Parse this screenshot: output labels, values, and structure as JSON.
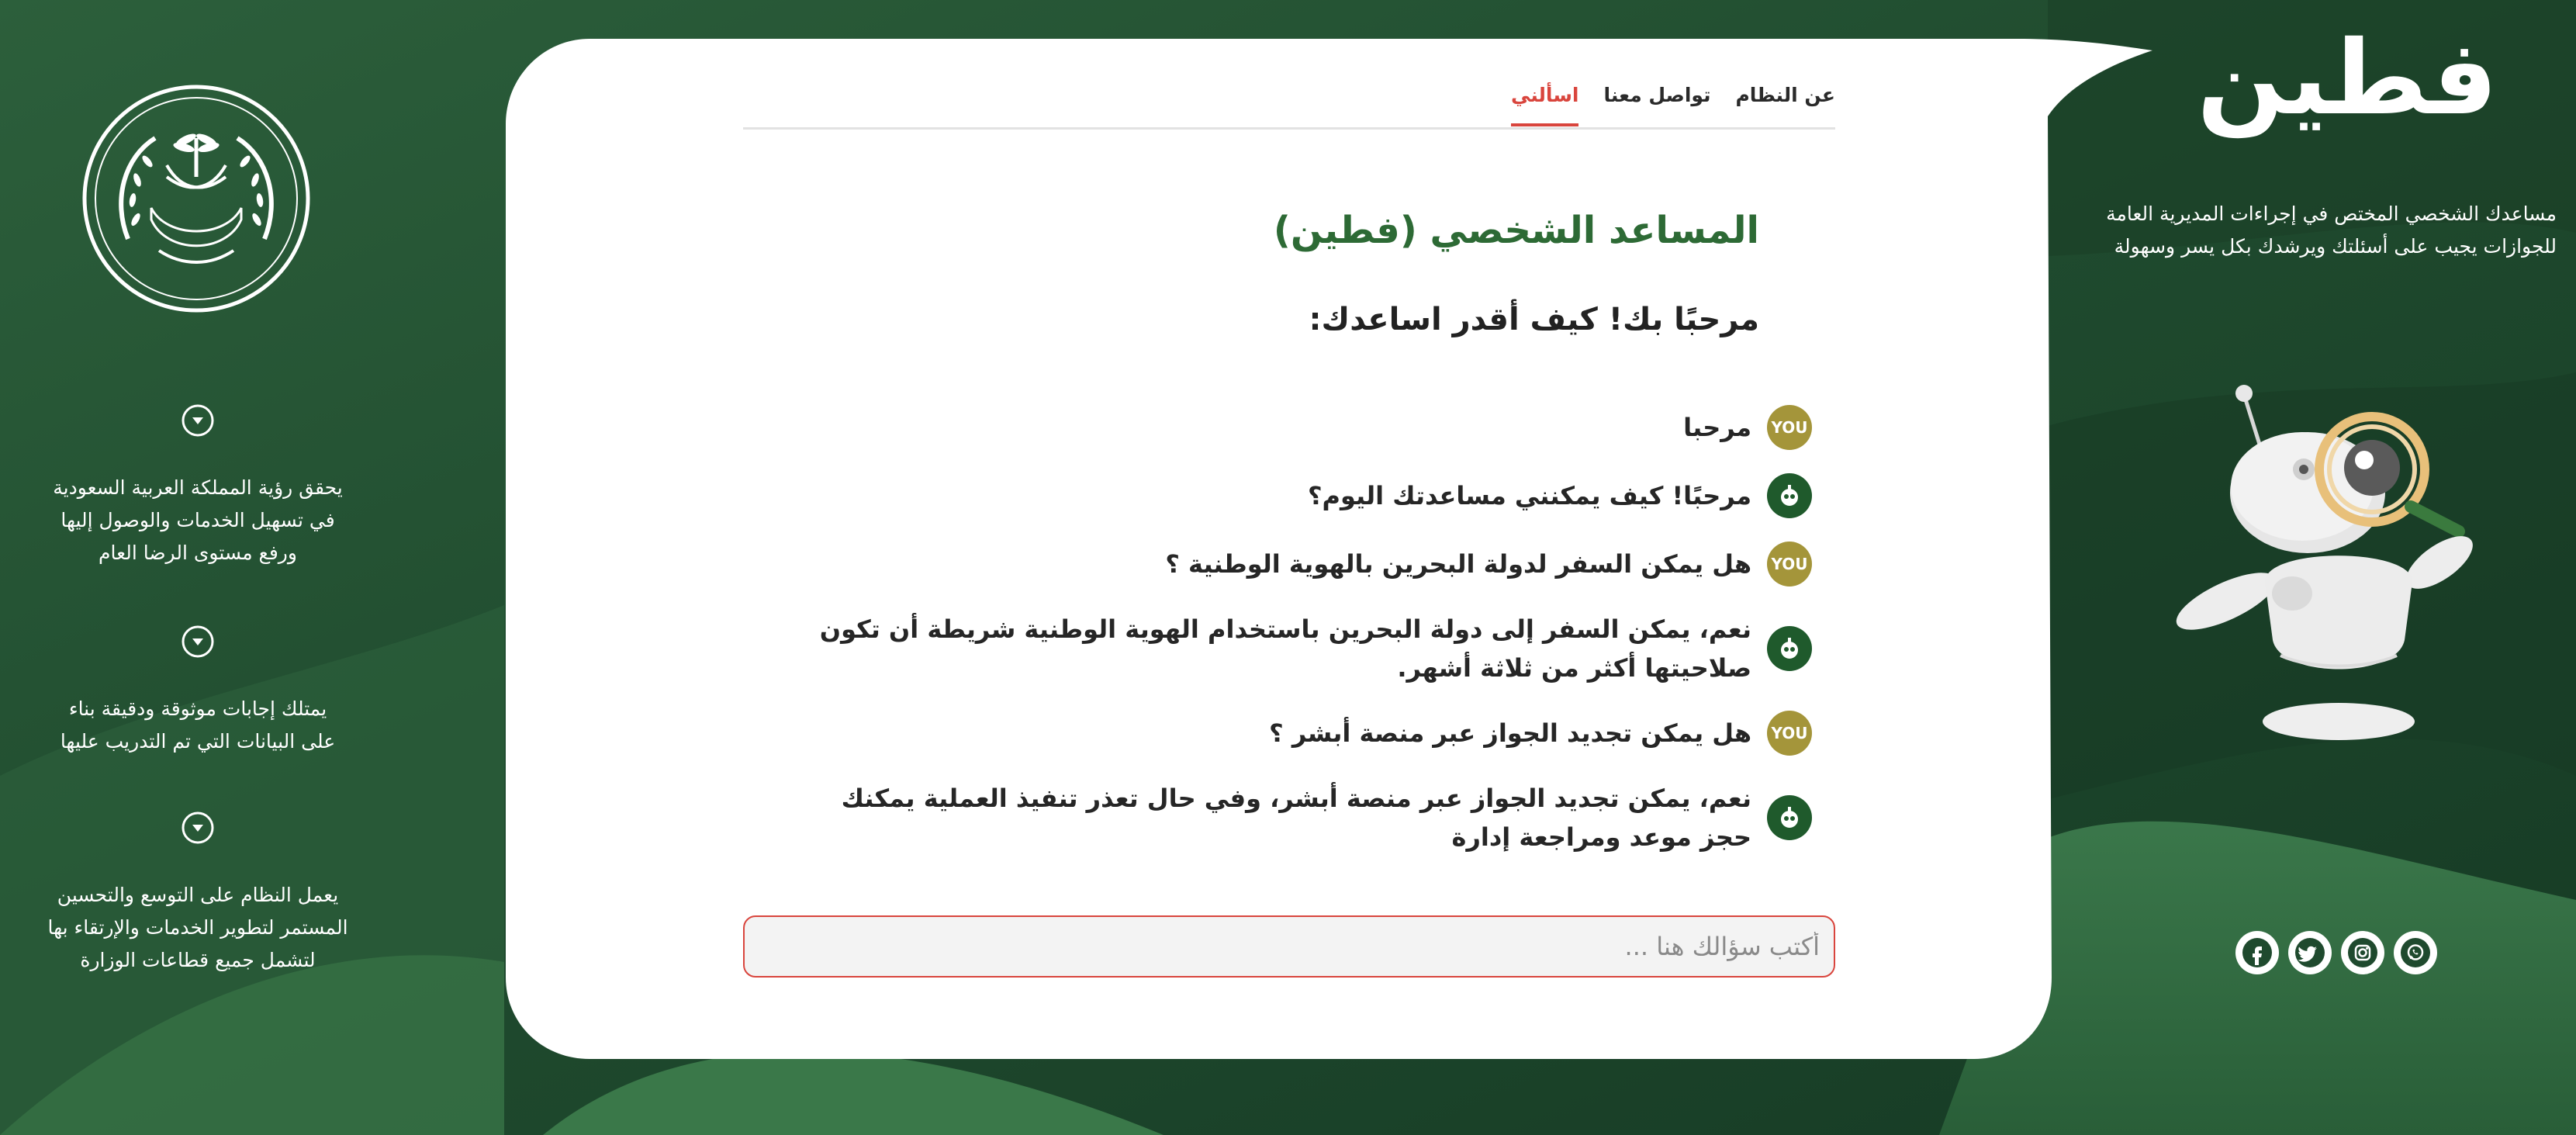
{
  "colors": {
    "dark_green": "#1e4a2e",
    "mid_green": "#2f6b3d",
    "accent_red": "#d9453d",
    "title_green": "#2d6a35",
    "user_badge": "#a4953a",
    "bot_badge": "#1f5a2c"
  },
  "brand": {
    "name": "فطين",
    "description_line1": "مساعدك الشخصي المختص في إجراءات المديرية العامة",
    "description_line2": "للجوازات يجيب على أسئلتك ويرشدك بكل يسر وسهولة"
  },
  "features": [
    {
      "icon": "chevron-down-icon",
      "line1": "يحقق رؤية المملكة العربية السعودية",
      "line2": "في تسهيل الخدمات والوصول إليها",
      "line3": "ورفع مستوى الرضا العام"
    },
    {
      "icon": "chevron-down-icon",
      "line1": "يمتلك إجابات موثوقة ودقيقة بناء",
      "line2": "على البيانات التي تم التدريب عليها",
      "line3": ""
    },
    {
      "icon": "chevron-down-icon",
      "line1": "يعمل النظام على التوسع والتحسين",
      "line2": "المستمر لتطوير الخدمات والإرتقاء بها",
      "line3": "لتشمل جميع قطاعات الوزارة"
    }
  ],
  "nav": {
    "tabs": [
      {
        "label": "اسألني",
        "active": true
      },
      {
        "label": "تواصل معنا",
        "active": false
      },
      {
        "label": "عن النظام",
        "active": false
      }
    ]
  },
  "main": {
    "title": "المساعد الشخصي (فطين)",
    "greeting": "مرحبًا بك! كيف أقدر اساعدك:"
  },
  "user_badge_label": "YOU",
  "messages": [
    {
      "role": "user",
      "text": "مرحبا"
    },
    {
      "role": "bot",
      "text": "مرحبًا! كيف يمكنني مساعدتك اليوم؟"
    },
    {
      "role": "user",
      "text": "هل يمكن السفر لدولة البحرين بالهوية الوطنية ؟"
    },
    {
      "role": "bot",
      "text": "نعم، يمكن السفر إلى دولة البحرين باستخدام الهوية الوطنية شريطة أن تكون صلاحيتها أكثر من ثلاثة أشهر."
    },
    {
      "role": "user",
      "text": "هل يمكن تجديد الجواز عبر منصة أبشر ؟"
    },
    {
      "role": "bot",
      "text": "نعم، يمكن تجديد الجواز عبر منصة أبشر، وفي حال تعذر تنفيذ العملية يمكنك حجز موعد ومراجعة إدارة"
    }
  ],
  "input": {
    "placeholder": "أكتب سؤالك هنا ...",
    "value": ""
  },
  "socials": [
    {
      "icon": "whatsapp-icon"
    },
    {
      "icon": "instagram-icon"
    },
    {
      "icon": "twitter-icon"
    },
    {
      "icon": "facebook-icon"
    }
  ]
}
